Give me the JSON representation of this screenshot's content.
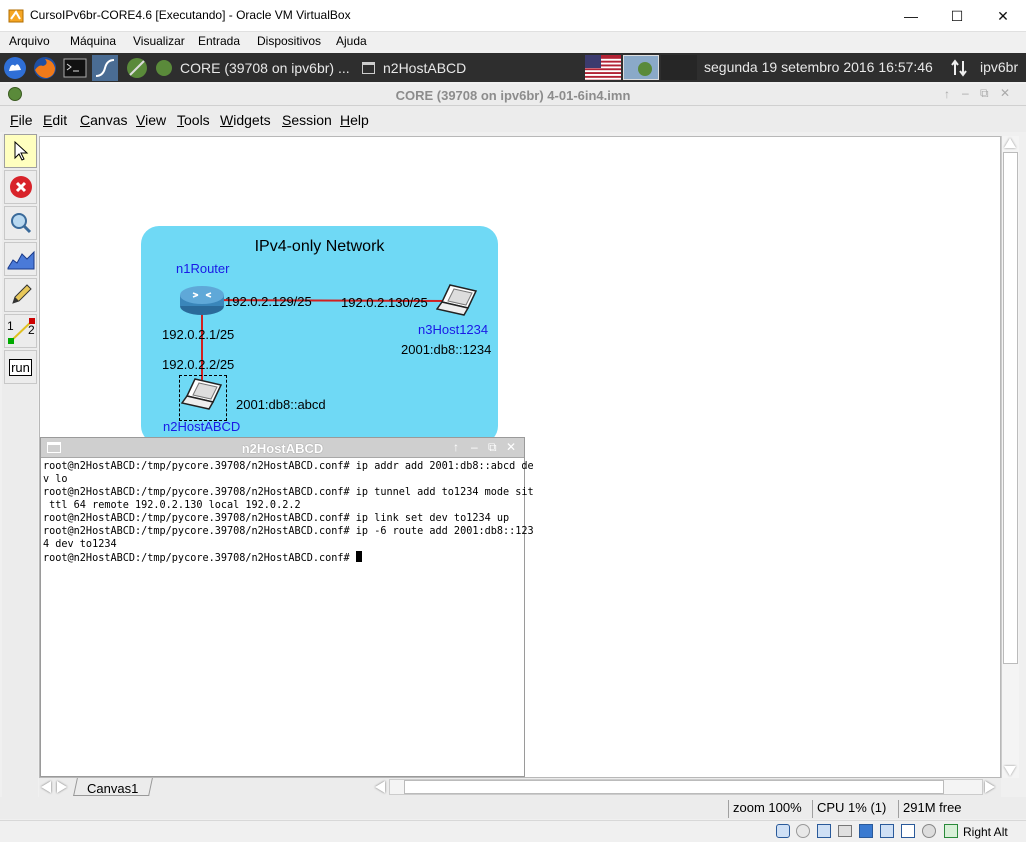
{
  "vbox": {
    "title": "CursoIPv6br-CORE4.6 [Executando] - Oracle VM VirtualBox",
    "menu": [
      "Arquivo",
      "Máquina",
      "Visualizar",
      "Entrada",
      "Dispositivos",
      "Ajuda"
    ],
    "status_host_key": "Right Alt"
  },
  "guest_panel": {
    "tasks": [
      "CORE (39708 on ipv6br) ...",
      "n2HostABCD"
    ],
    "clock": "segunda 19 setembro 2016 16:57:46",
    "user": "ipv6br"
  },
  "core": {
    "title": "CORE (39708 on ipv6br) 4-01-6in4.imn",
    "menu": [
      {
        "ul": "F",
        "rest": "ile"
      },
      {
        "ul": "E",
        "rest": "dit"
      },
      {
        "ul": "C",
        "rest": "anvas"
      },
      {
        "ul": "V",
        "rest": "iew"
      },
      {
        "ul": "T",
        "rest": "ools"
      },
      {
        "ul": "W",
        "rest": "idgets"
      },
      {
        "ul": "S",
        "rest": "ession"
      },
      {
        "ul": "H",
        "rest": "elp"
      }
    ],
    "toolbar": {
      "link_label_1": "1",
      "link_label_2": "2",
      "run_label": "run"
    },
    "canvas_tab": "Canvas1",
    "status": {
      "zoom": "zoom 100%",
      "cpu": "CPU 1% (1)",
      "mem": "291M free"
    }
  },
  "network": {
    "title": "IPv4-only Network",
    "n1": {
      "name": "n1Router"
    },
    "n2": {
      "name": "n2HostABCD",
      "addr6": "2001:db8::abcd"
    },
    "n3": {
      "name": "n3Host1234",
      "addr6": "2001:db8::1234"
    },
    "links": {
      "r_n3_near": "192.0.2.129/25",
      "r_n3_far": "192.0.2.130/25",
      "r_n2_near": "192.0.2.1/25",
      "r_n2_far": "192.0.2.2/25"
    }
  },
  "terminal": {
    "title": "n2HostABCD",
    "lines": [
      "root@n2HostABCD:/tmp/pycore.39708/n2HostABCD.conf# ip addr add 2001:db8::abcd de",
      "v lo",
      "root@n2HostABCD:/tmp/pycore.39708/n2HostABCD.conf# ip tunnel add to1234 mode sit",
      " ttl 64 remote 192.0.2.130 local 192.0.2.2",
      "root@n2HostABCD:/tmp/pycore.39708/n2HostABCD.conf# ip link set dev to1234 up",
      "root@n2HostABCD:/tmp/pycore.39708/n2HostABCD.conf# ip -6 route add 2001:db8::123",
      "4 dev to1234"
    ],
    "prompt": "root@n2HostABCD:/tmp/pycore.39708/n2HostABCD.conf# "
  }
}
